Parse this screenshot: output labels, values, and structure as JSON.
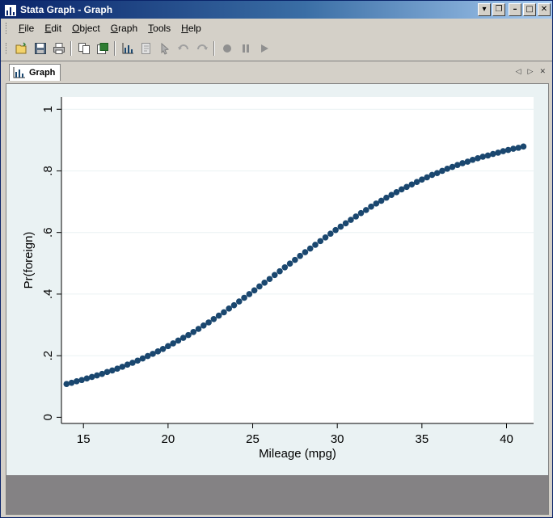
{
  "window": {
    "title": "Stata Graph - Graph",
    "buttons": [
      "▾",
      "❐",
      "–",
      "□",
      "✕"
    ]
  },
  "menu": {
    "items": [
      {
        "label": "File",
        "mnemonic": "F",
        "rest": "ile"
      },
      {
        "label": "Edit",
        "mnemonic": "E",
        "rest": "dit"
      },
      {
        "label": "Object",
        "mnemonic": "O",
        "rest": "bject"
      },
      {
        "label": "Graph",
        "mnemonic": "G",
        "rest": "raph"
      },
      {
        "label": "Tools",
        "mnemonic": "T",
        "rest": "ools"
      },
      {
        "label": "Help",
        "mnemonic": "H",
        "rest": "elp"
      }
    ]
  },
  "toolbar": {
    "icons": [
      "open-icon",
      "save-icon",
      "print-icon",
      "copy-icon",
      "rename-icon",
      "graph-editor-icon",
      "object-browser-icon",
      "pointer-icon",
      "undo-icon",
      "redo-icon",
      "record-icon",
      "pause-icon",
      "play-icon"
    ]
  },
  "tabs": {
    "active": "Graph"
  },
  "colors": {
    "marker": "#1a476f",
    "plot_bg": "#ffffff",
    "graph_bg": "#eaf2f3",
    "footer": "#848284"
  },
  "chart_data": {
    "type": "scatter",
    "xlabel": "Mileage (mpg)",
    "ylabel": "Pr(foreign)",
    "xlim": [
      14,
      41
    ],
    "ylim": [
      0,
      1
    ],
    "xticks": [
      15,
      20,
      25,
      30,
      35,
      40
    ],
    "xtick_labels": [
      "15",
      "20",
      "25",
      "30",
      "35",
      "40"
    ],
    "yticks": [
      0,
      0.2,
      0.4,
      0.6,
      0.8,
      1
    ],
    "ytick_labels": [
      "0",
      ".2",
      ".4",
      ".6",
      ".8",
      "1"
    ],
    "grid": true,
    "series": [
      {
        "marker": "filled-circle",
        "x_step": 0.3,
        "x": [
          14,
          14.3,
          14.6,
          14.9,
          15.2,
          15.5,
          15.8,
          16.1,
          16.4,
          16.7,
          17,
          17.3,
          17.6,
          17.9,
          18.2,
          18.5,
          18.8,
          19.1,
          19.4,
          19.7,
          20,
          20.3,
          20.6,
          20.9,
          21.2,
          21.5,
          21.8,
          22.1,
          22.4,
          22.7,
          23,
          23.3,
          23.6,
          23.9,
          24.2,
          24.5,
          24.8,
          25.1,
          25.4,
          25.7,
          26,
          26.3,
          26.6,
          26.9,
          27.2,
          27.5,
          27.8,
          28.1,
          28.4,
          28.7,
          29,
          29.3,
          29.6,
          29.9,
          30.2,
          30.5,
          30.8,
          31.1,
          31.4,
          31.7,
          32,
          32.3,
          32.6,
          32.9,
          33.2,
          33.5,
          33.8,
          34.1,
          34.4,
          34.7,
          35,
          35.3,
          35.6,
          35.9,
          36.2,
          36.5,
          36.8,
          37.1,
          37.4,
          37.7,
          38,
          38.3,
          38.6,
          38.9,
          39.2,
          39.5,
          39.8,
          40.1,
          40.4,
          40.7,
          41
        ],
        "y": [
          0.108,
          0.112,
          0.117,
          0.121,
          0.126,
          0.131,
          0.136,
          0.141,
          0.147,
          0.152,
          0.158,
          0.164,
          0.171,
          0.177,
          0.184,
          0.191,
          0.199,
          0.206,
          0.214,
          0.222,
          0.231,
          0.24,
          0.249,
          0.258,
          0.267,
          0.277,
          0.287,
          0.298,
          0.308,
          0.319,
          0.33,
          0.341,
          0.353,
          0.364,
          0.376,
          0.388,
          0.4,
          0.412,
          0.425,
          0.437,
          0.449,
          0.462,
          0.474,
          0.487,
          0.499,
          0.511,
          0.524,
          0.536,
          0.548,
          0.56,
          0.572,
          0.584,
          0.596,
          0.608,
          0.619,
          0.63,
          0.641,
          0.652,
          0.663,
          0.673,
          0.684,
          0.694,
          0.703,
          0.713,
          0.722,
          0.731,
          0.74,
          0.748,
          0.756,
          0.764,
          0.772,
          0.779,
          0.787,
          0.793,
          0.8,
          0.807,
          0.813,
          0.819,
          0.825,
          0.83,
          0.836,
          0.841,
          0.846,
          0.85,
          0.855,
          0.859,
          0.864,
          0.868,
          0.872,
          0.875,
          0.879
        ]
      }
    ]
  }
}
